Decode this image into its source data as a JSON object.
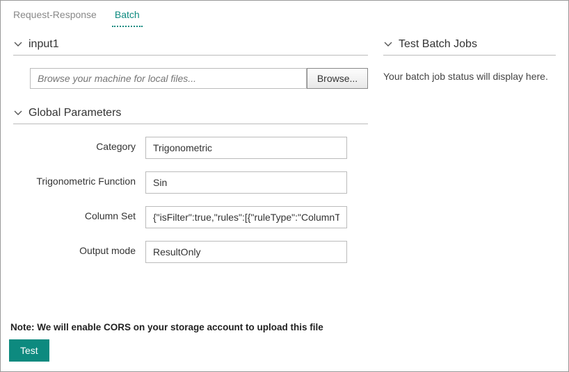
{
  "tabs": {
    "request_response": "Request-Response",
    "batch": "Batch"
  },
  "sections": {
    "input1": {
      "title": "input1"
    },
    "global_params": {
      "title": "Global Parameters"
    },
    "test_jobs": {
      "title": "Test Batch Jobs"
    }
  },
  "file": {
    "placeholder": "Browse your machine for local files...",
    "browse_label": "Browse..."
  },
  "params": {
    "category": {
      "label": "Category",
      "value": "Trigonometric"
    },
    "trig_function": {
      "label": "Trigonometric Function",
      "value": "Sin"
    },
    "column_set": {
      "label": "Column Set",
      "value": "{\"isFilter\":true,\"rules\":[{\"ruleType\":\"ColumnTyp"
    },
    "output_mode": {
      "label": "Output mode",
      "value": "ResultOnly"
    }
  },
  "batch_status": "Your batch job status will display here.",
  "note": "Note: We will enable CORS on your storage account to upload this file",
  "test_button": "Test"
}
